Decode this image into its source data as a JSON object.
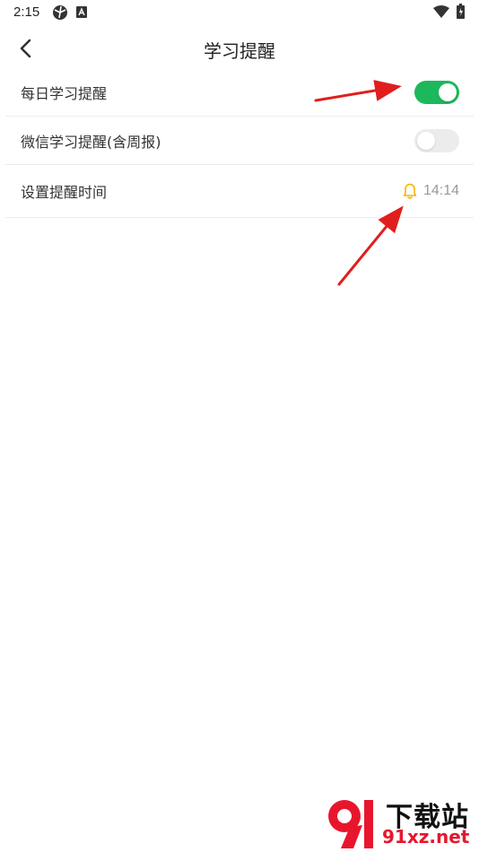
{
  "status_bar": {
    "time": "2:15",
    "icons": [
      "ball-icon",
      "a-icon",
      "wifi-icon",
      "battery-icon"
    ]
  },
  "header": {
    "back_icon": "chevron-left-icon",
    "title": "学习提醒"
  },
  "settings": [
    {
      "label": "每日学习提醒",
      "type": "toggle",
      "enabled": true
    },
    {
      "label": "微信学习提醒(含周报)",
      "type": "toggle",
      "enabled": false
    },
    {
      "label": "设置提醒时间",
      "type": "time",
      "icon": "bell-icon",
      "value": "14:14"
    }
  ],
  "colors": {
    "toggle_on": "#1db85c",
    "toggle_off": "#ececec",
    "bell": "#f5b400",
    "annotation_arrow": "#e01e1e"
  },
  "watermark": {
    "line1": "下载站",
    "line2": "91xz.net",
    "logo_text": "9"
  }
}
